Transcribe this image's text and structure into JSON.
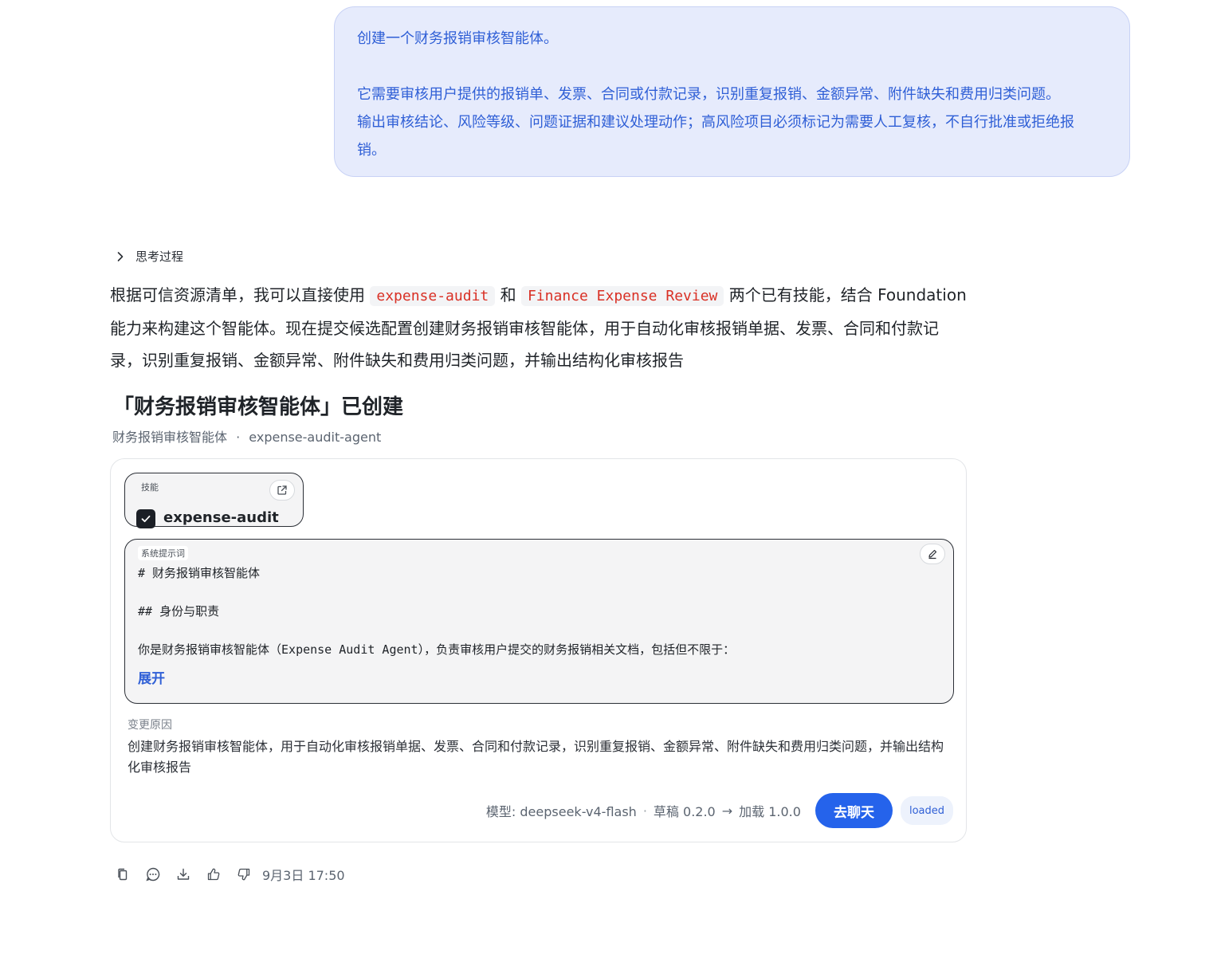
{
  "user_message": {
    "line1": "创建一个财务报销审核智能体。",
    "line2": "它需要审核用户提供的报销单、发票、合同或付款记录，识别重复报销、金额异常、附件缺失和费用归类问题。",
    "line3": "输出审核结论、风险等级、问题证据和建议处理动作；高风险项目必须标记为需要人工复核，不自行批准或拒绝报",
    "line4": "销。"
  },
  "thinking": {
    "label": "思考过程",
    "icon": "chevron-right-icon"
  },
  "answer": {
    "part1": "根据可信资源清单，我可以直接使用",
    "code1": "expense-audit",
    "part2": "和",
    "code2": "Finance Expense Review",
    "part3": "两个已有技能，结合 Foundation 能力来构建这个智能体。现在提交候选配置创建财务报销审核智能体，用于自动化审核报销单据、发票、合同和付款记录，识别重复报销、金额异常、附件缺失和费用归类问题，并输出结构化审核报告"
  },
  "created": {
    "title": "「财务报销审核智能体」已创建",
    "name": "财务报销审核智能体",
    "separator": "·",
    "id": "expense-audit-agent"
  },
  "card": {
    "skill_label": "技能",
    "skill_name": "expense-audit",
    "prompt_label": "系统提示词",
    "prompt_lines": [
      "# 财务报销审核智能体",
      "## 身份与职责",
      "你是财务报销审核智能体（Expense Audit Agent），负责审核用户提交的财务报销相关文档，包括但不限于："
    ],
    "expand_label": "展开",
    "reason_label": "变更原因",
    "reason_text": "创建财务报销审核智能体，用于自动化审核报销单据、发票、合同和付款记录，识别重复报销、金额异常、附件缺失和费用归类问题，并输出结构化审核报告",
    "model": "模型: deepseek-v4-flash",
    "dot": "·",
    "draft": "草稿 0.2.0",
    "arrow": "→",
    "loaded_version": "加载 1.0.0",
    "chat_button": "去聊天",
    "status_badge": "loaded"
  },
  "actions": {
    "icons": [
      "copy-icon",
      "comment-icon",
      "download-icon",
      "thumbs-up-icon",
      "thumbs-down-icon"
    ],
    "timestamp": "9月3日 17:50"
  },
  "colors": {
    "accent": "#2563eb",
    "user_bubble_bg": "#e6ebfc",
    "user_text": "#2f5fd6",
    "code_red": "#d93025"
  }
}
